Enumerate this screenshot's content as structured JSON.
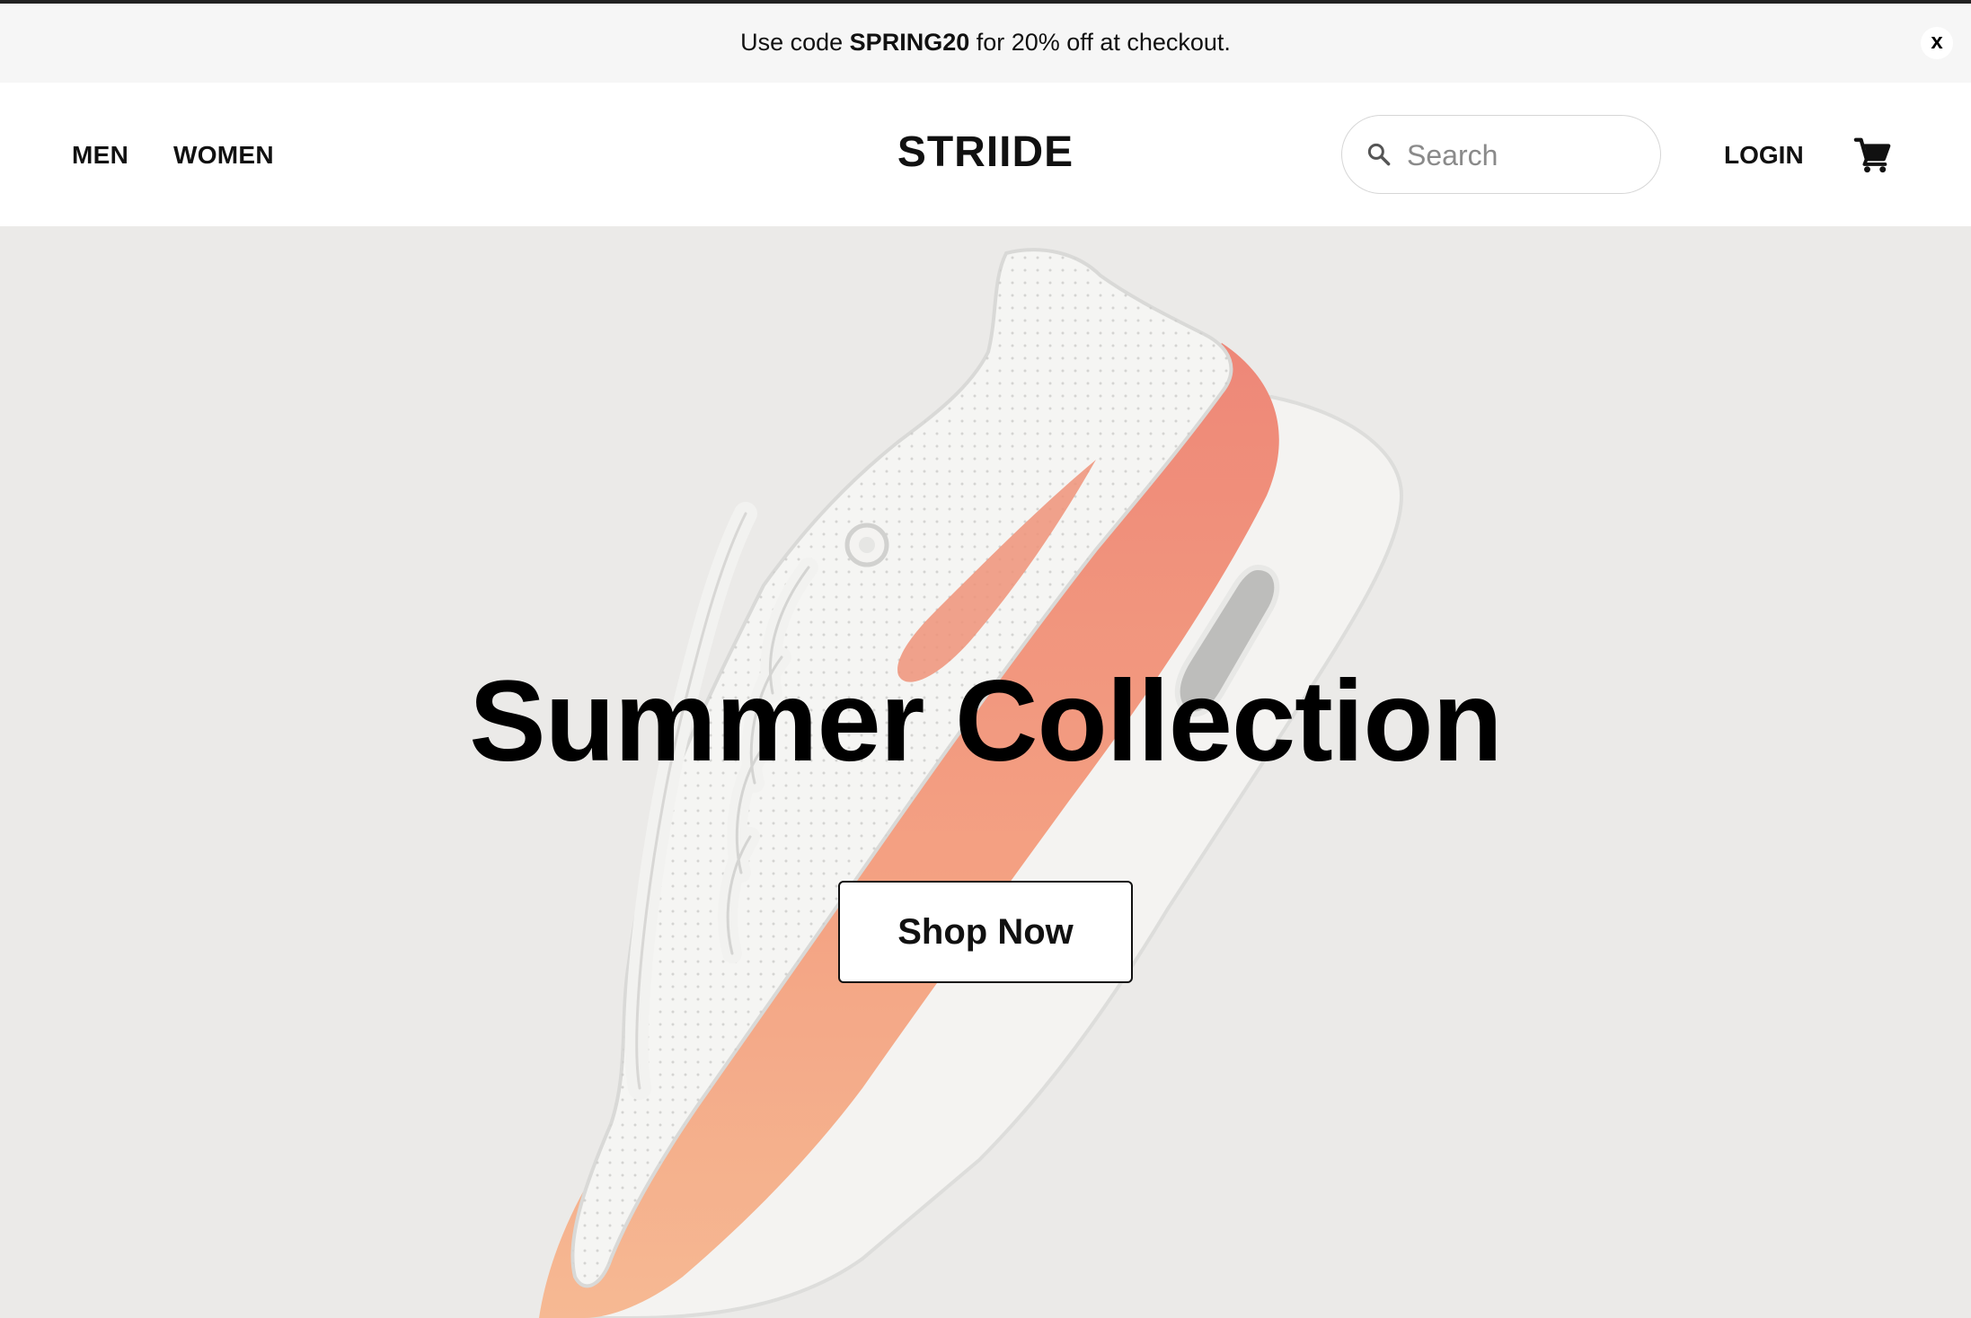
{
  "promo": {
    "text_before": "Use code ",
    "code": "SPRING20",
    "text_after": " for 20% off at checkout.",
    "close_label": "x"
  },
  "nav": {
    "men": "MEN",
    "women": "WOMEN"
  },
  "brand": {
    "logo": "STRIIDE"
  },
  "search": {
    "placeholder": "Search",
    "value": ""
  },
  "account": {
    "login": "LOGIN"
  },
  "icons": {
    "search": "search-icon",
    "cart": "cart-icon",
    "close": "close-icon"
  },
  "hero": {
    "title": "Summer Collection",
    "button_label": "Shop Now",
    "image": "sneaker-photo"
  },
  "colors": {
    "promo_bg": "#f6f6f6",
    "hero_bg": "#ebeae8",
    "text": "#111111",
    "sneaker_accent": "#f0866a"
  }
}
